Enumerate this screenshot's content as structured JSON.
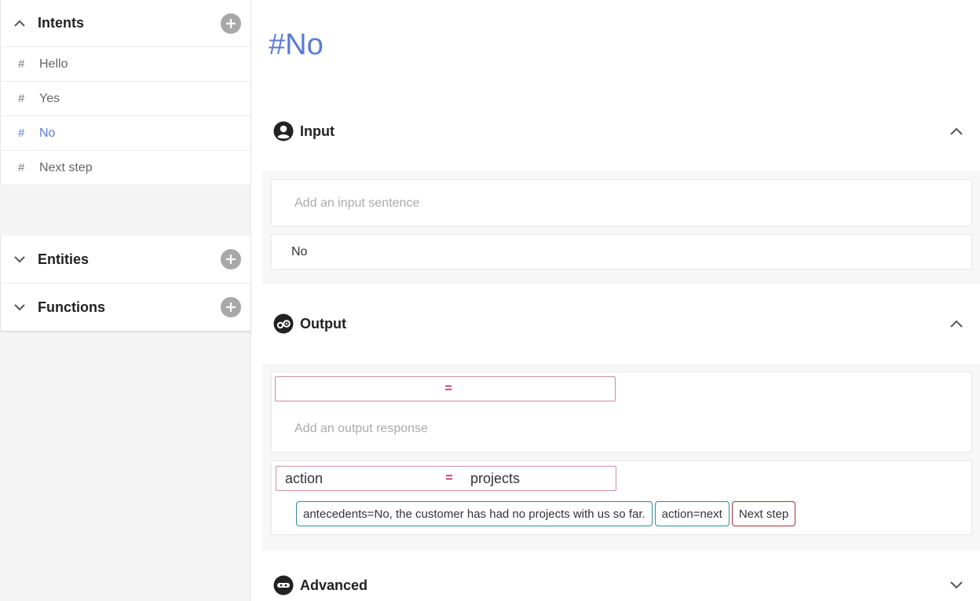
{
  "sidebar": {
    "intents": {
      "title": "Intents",
      "items": [
        {
          "hash": "#",
          "label": "Hello"
        },
        {
          "hash": "#",
          "label": "Yes"
        },
        {
          "hash": "#",
          "label": "No"
        },
        {
          "hash": "#",
          "label": "Next step"
        }
      ]
    },
    "entities": {
      "title": "Entities"
    },
    "functions": {
      "title": "Functions"
    }
  },
  "main": {
    "title": "#No",
    "input": {
      "title": "Input",
      "placeholder": "Add an input sentence",
      "sentences": [
        "No"
      ]
    },
    "output": {
      "title": "Output",
      "empty_assignment": {
        "lhs": "",
        "eq": "=",
        "rhs": ""
      },
      "placeholder": "Add an output response",
      "assignment": {
        "lhs": "action",
        "eq": "=",
        "rhs": "projects"
      },
      "chips": [
        "antecedents=No, the customer has had no projects with us so far.",
        "action=next",
        "Next step"
      ]
    },
    "advanced": {
      "title": "Advanced"
    }
  },
  "colors": {
    "accent": "#5b7bd5",
    "chip_teal": "#2e8f94",
    "chip_red": "#a5303a",
    "equals": "#c0306a"
  }
}
